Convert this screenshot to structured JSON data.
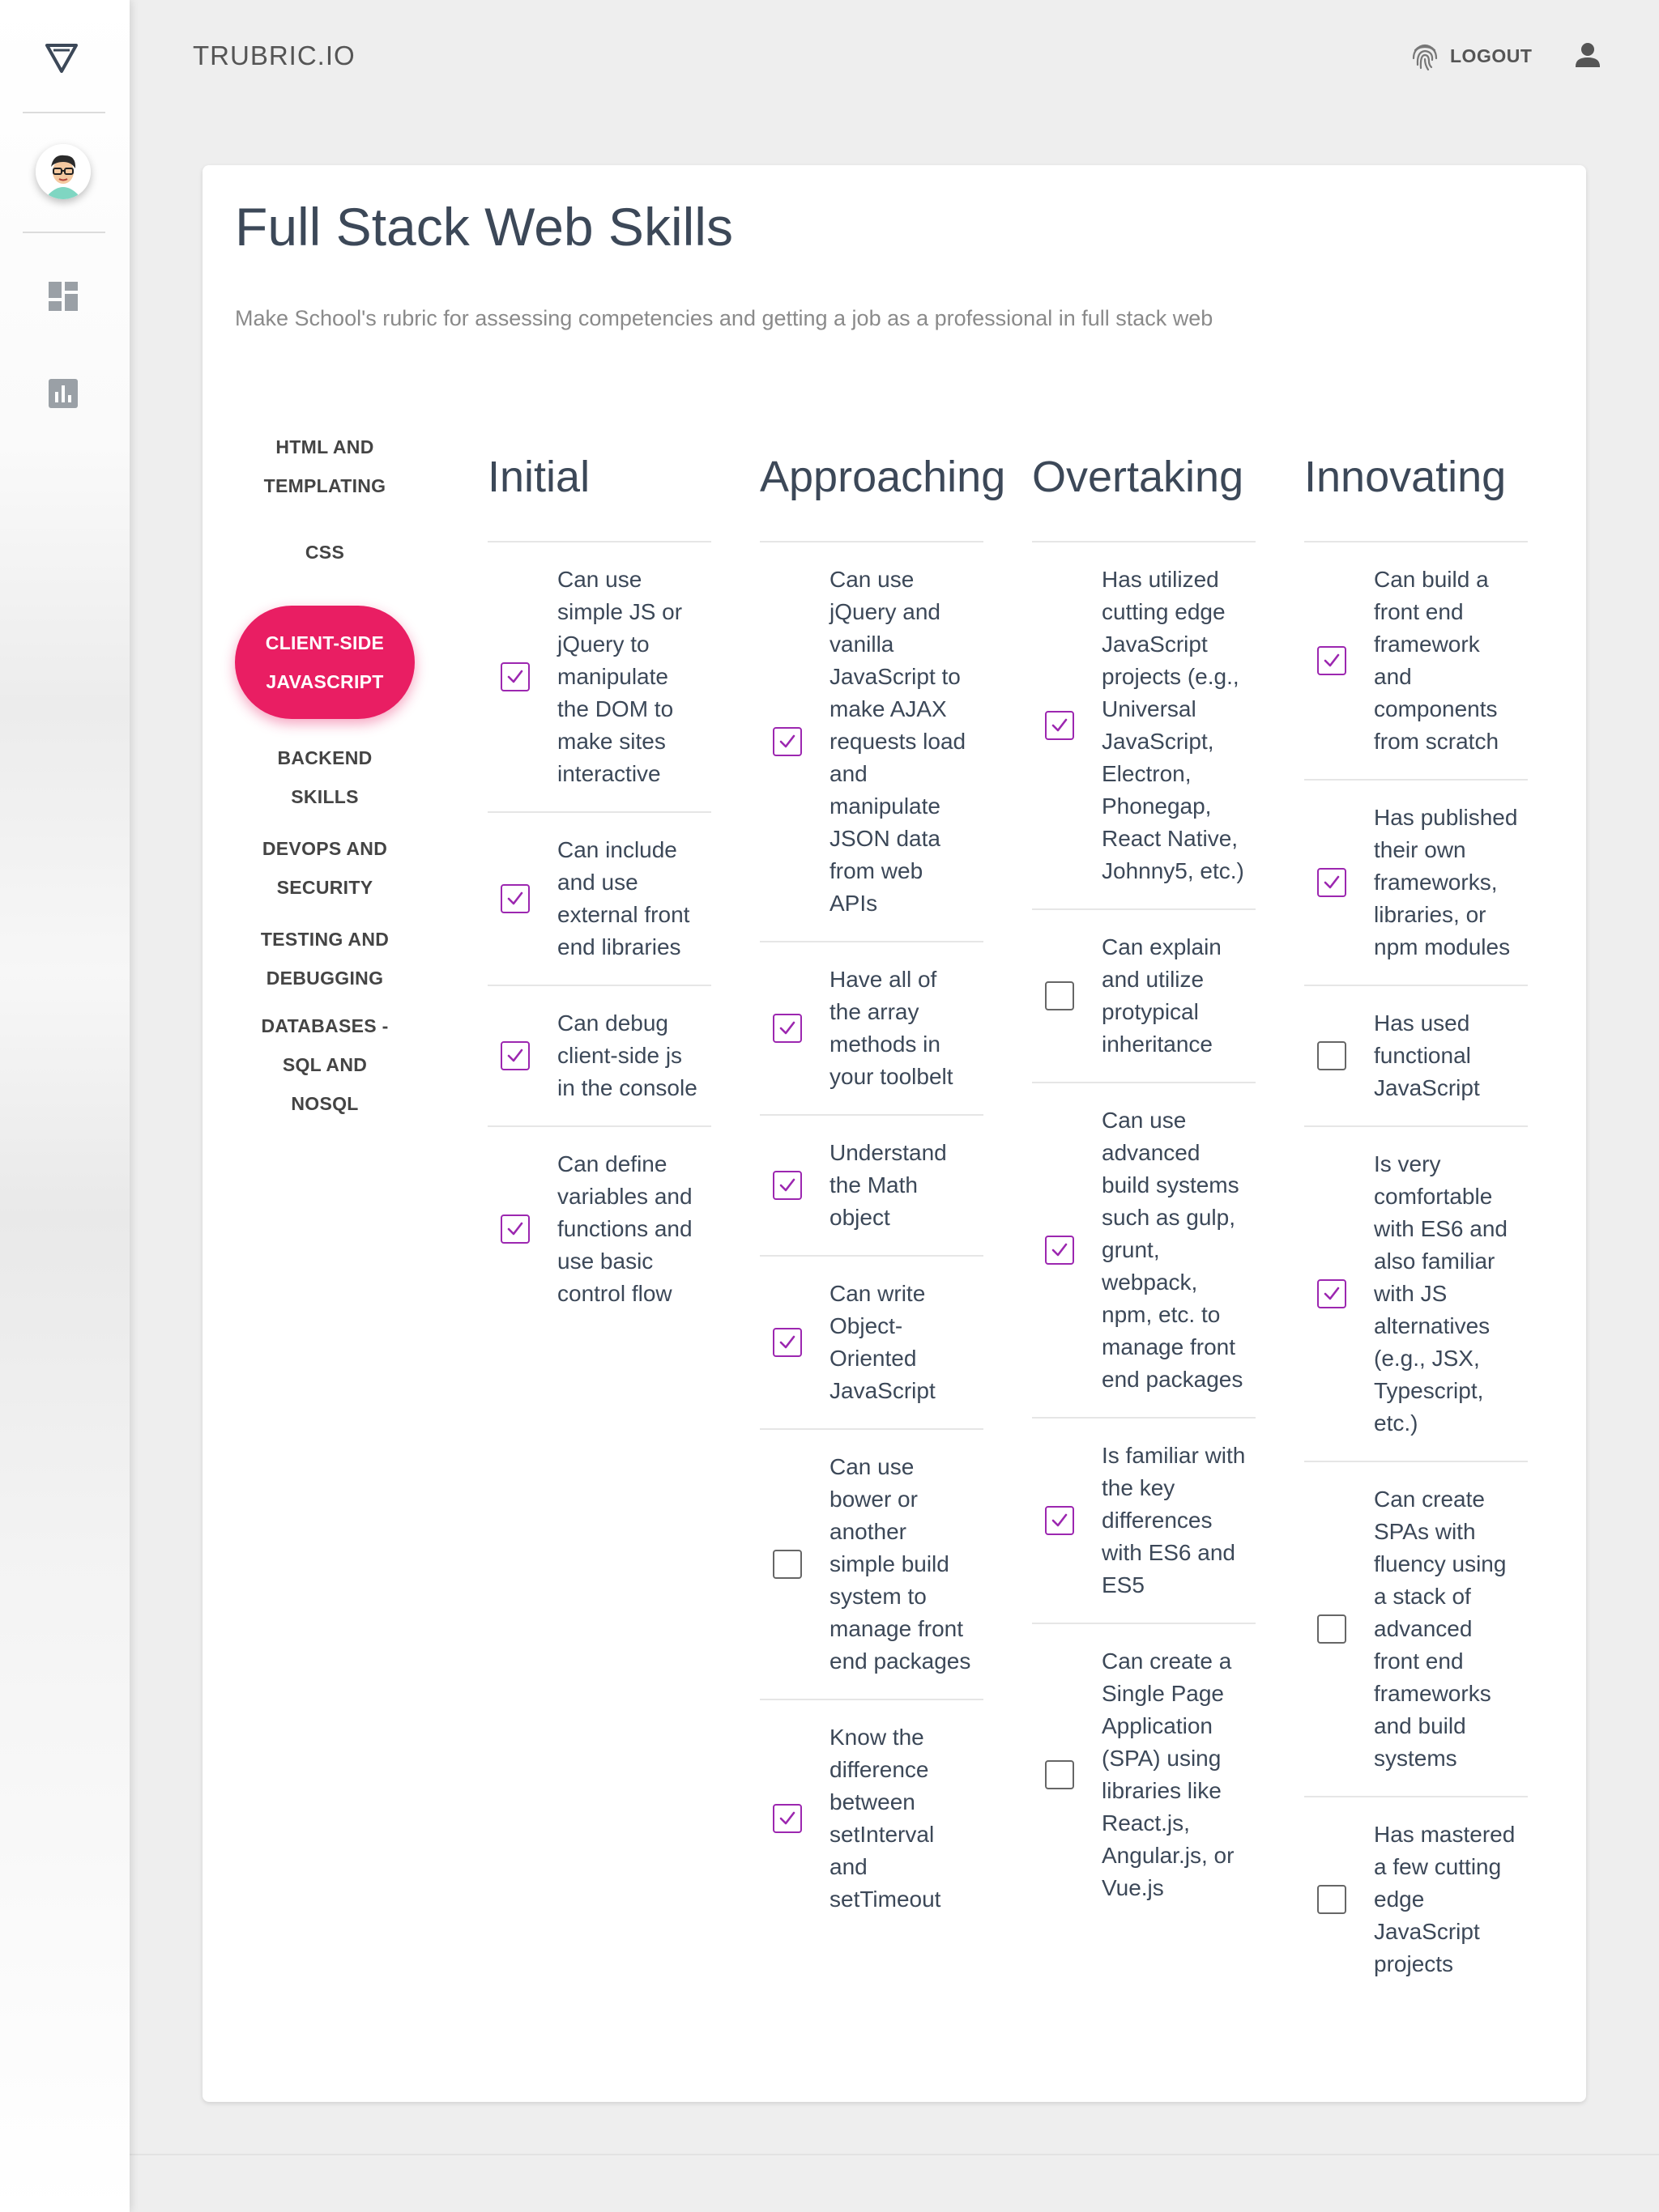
{
  "header": {
    "brand": "TRUBRIC.IO",
    "logout_label": "LOGOUT"
  },
  "sidebar": {
    "icons": [
      "logo-triangle-icon",
      "avatar",
      "dashboard-icon",
      "bar-chart-icon"
    ]
  },
  "page": {
    "title": "Full Stack Web Skills",
    "subtitle": "Make School's rubric for assessing competencies and getting a job as a professional in full stack web"
  },
  "categories": [
    {
      "label": "HTML AND TEMPLATING",
      "active": false
    },
    {
      "label": "CSS",
      "active": false
    },
    {
      "label": "CLIENT-SIDE JAVASCRIPT",
      "active": true
    },
    {
      "label": "BACKEND SKILLS",
      "active": false
    },
    {
      "label": "DEVOPS AND SECURITY",
      "active": false
    },
    {
      "label": "TESTING AND DEBUGGING",
      "active": false
    },
    {
      "label": "DATABASES - SQL AND NOSQL",
      "active": false
    }
  ],
  "colors": {
    "accent_pink": "#e91e63",
    "check_purple": "#9c27b0",
    "title_text": "#3c4858"
  },
  "columns": [
    {
      "heading": "Initial",
      "skills": [
        {
          "text": "Can use simple JS or jQuery to manipulate the DOM to make sites interactive",
          "checked": true
        },
        {
          "text": "Can include and use external front end libraries",
          "checked": true
        },
        {
          "text": "Can debug client-side js in the console",
          "checked": true
        },
        {
          "text": "Can define variables and functions and use basic control flow",
          "checked": true
        }
      ]
    },
    {
      "heading": "Approaching",
      "skills": [
        {
          "text": "Can use jQuery and vanilla JavaScript to make AJAX requests load and manipulate JSON data from web APIs",
          "checked": true
        },
        {
          "text": "Have all of the array methods in your toolbelt",
          "checked": true
        },
        {
          "text": "Understand the Math object",
          "checked": true
        },
        {
          "text": "Can write Object-Oriented JavaScript",
          "checked": true
        },
        {
          "text": "Can use bower or another simple build system to manage front end packages",
          "checked": false
        },
        {
          "text": "Know the difference between setInterval and setTimeout",
          "checked": true
        }
      ]
    },
    {
      "heading": "Overtaking",
      "skills": [
        {
          "text": "Has utilized cutting edge JavaScript projects (e.g., Universal JavaScript, Electron, Phonegap, React Native, Johnny5, etc.)",
          "checked": true
        },
        {
          "text": "Can explain and utilize protypical inheritance",
          "checked": false
        },
        {
          "text": "Can use advanced build systems such as gulp, grunt, webpack, npm, etc. to manage front end packages",
          "checked": true
        },
        {
          "text": "Is familiar with the key differences with ES6 and ES5",
          "checked": true
        },
        {
          "text": "Can create a Single Page Application (SPA) using libraries like React.js, Angular.js, or Vue.js",
          "checked": false
        }
      ]
    },
    {
      "heading": "Innovating",
      "skills": [
        {
          "text": "Can build a front end framework and components from scratch",
          "checked": true
        },
        {
          "text": "Has published their own frameworks, libraries, or npm modules",
          "checked": true
        },
        {
          "text": "Has used functional JavaScript",
          "checked": false
        },
        {
          "text": "Is very comfortable with ES6 and also familiar with JS alternatives (e.g., JSX, Typescript, etc.)",
          "checked": true
        },
        {
          "text": "Can create SPAs with fluency using a stack of advanced front end frameworks and build systems",
          "checked": false
        },
        {
          "text": "Has mastered a few cutting edge JavaScript projects",
          "checked": false
        }
      ]
    }
  ]
}
